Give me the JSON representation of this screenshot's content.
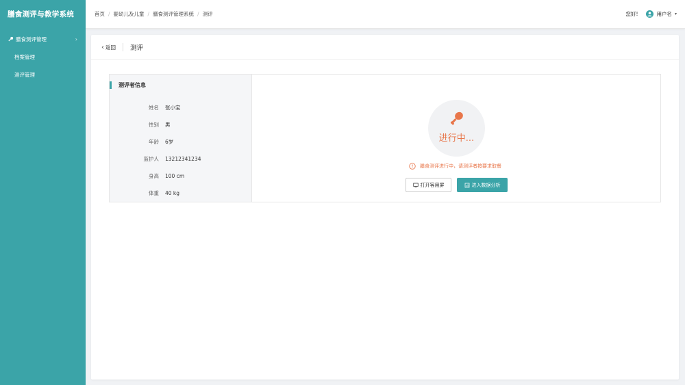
{
  "app": {
    "title": "膳食测评与教学系统"
  },
  "sidebar": {
    "group": {
      "label": "膳食测评管理",
      "icon": "key-icon"
    },
    "items": [
      {
        "label": "档案管理"
      },
      {
        "label": "测评管理"
      }
    ]
  },
  "header": {
    "breadcrumb": [
      "首页",
      "婴幼儿及儿童",
      "膳食测评管理系统",
      "测评"
    ],
    "greeting": "您好!",
    "username": "用户名"
  },
  "page": {
    "back_label": "返回",
    "title": "测评"
  },
  "info": {
    "title": "测评者信息",
    "fields": [
      {
        "key": "姓名",
        "value": "张小宝"
      },
      {
        "key": "性别",
        "value": "男"
      },
      {
        "key": "年龄",
        "value": "6岁"
      },
      {
        "key": "监护人",
        "value": "13212341234"
      },
      {
        "key": "身高",
        "value": "100 cm"
      },
      {
        "key": "体重",
        "value": "40 kg"
      }
    ]
  },
  "status": {
    "text": "进行中...",
    "alert": "膳食测评进行中，请测评者按要求取餐",
    "btn_customer_screen": "打开客用屏",
    "btn_analysis": "进入数据分析"
  },
  "colors": {
    "accent": "#3ba4a8",
    "status": "#e8764a"
  }
}
